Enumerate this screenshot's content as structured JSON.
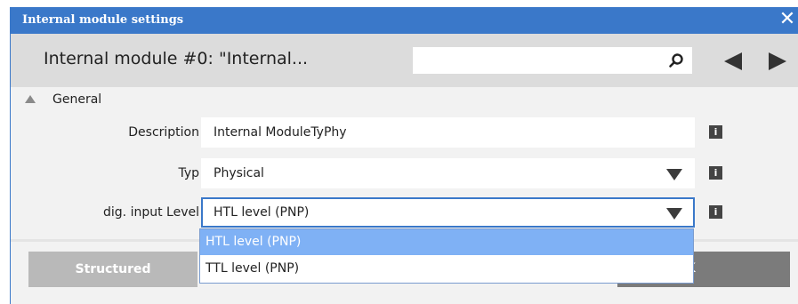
{
  "window": {
    "title": "Internal module settings",
    "close_glyph": "✕"
  },
  "header": {
    "module_name": "Internal module #0: \"Internal...",
    "search_value": ""
  },
  "section": {
    "label": "General"
  },
  "fields": {
    "description": {
      "label": "Description",
      "value": "Internal ModuleTyPhy"
    },
    "typ": {
      "label": "Typ",
      "value": "Physical"
    },
    "dig_input_level": {
      "label": "dig. input Level",
      "value": "HTL level (PNP)"
    }
  },
  "info_glyph": "i",
  "dropdown": {
    "options": [
      "HTL level (PNP)",
      "TTL level (PNP)"
    ],
    "selected": "HTL level (PNP)"
  },
  "buttons": {
    "structured": "Structured",
    "ok_visible": "OK",
    "ok_partial": "OK"
  },
  "colors": {
    "titlebar": "#3a78c9",
    "header_bg": "#dcdcdc",
    "selected_option": "#7fb1f5",
    "ok_button": "#7b7b7b",
    "structured_button": "#b9b9b9"
  },
  "icons": {
    "search": "magnifier-icon",
    "prev": "arrow-left-icon",
    "next": "arrow-right-icon",
    "collapse": "triangle-up-icon",
    "dropdown": "chevron-down-icon",
    "info": "info-icon"
  }
}
